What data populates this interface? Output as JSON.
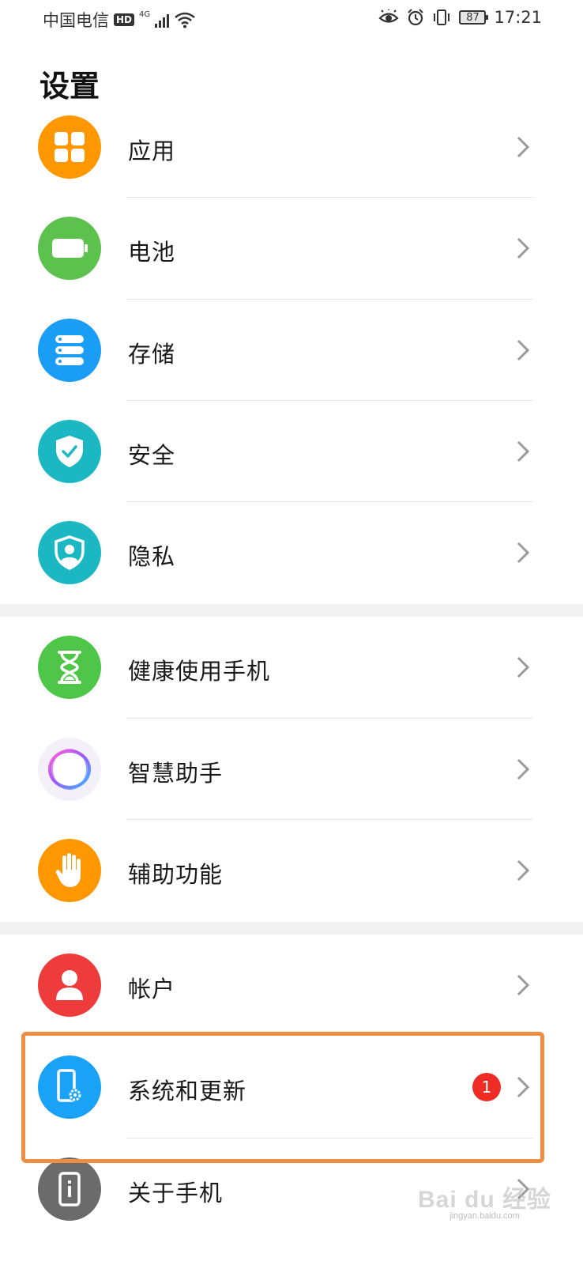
{
  "status_bar": {
    "carrier": "中国电信",
    "hd": "HD",
    "network": "4G",
    "battery": "87",
    "time": "17:21"
  },
  "page_title": "设置",
  "items": [
    {
      "label": "应用",
      "icon": "apps-icon",
      "color": "#ff9800"
    },
    {
      "label": "电池",
      "icon": "battery-icon",
      "color": "#5cc24d"
    },
    {
      "label": "存储",
      "icon": "storage-icon",
      "color": "#1a9ef5"
    },
    {
      "label": "安全",
      "icon": "security-shield-icon",
      "color": "#1bb8c4"
    },
    {
      "label": "隐私",
      "icon": "privacy-shield-icon",
      "color": "#1bb8c4"
    },
    {
      "label": "健康使用手机",
      "icon": "hourglass-icon",
      "color": "#4fc64a"
    },
    {
      "label": "智慧助手",
      "icon": "assistant-ring-icon",
      "color": "#f3eff6"
    },
    {
      "label": "辅助功能",
      "icon": "hand-icon",
      "color": "#ff9800"
    },
    {
      "label": "帐户",
      "icon": "user-icon",
      "color": "#ee3b3b"
    },
    {
      "label": "系统和更新",
      "icon": "phone-gear-icon",
      "color": "#1aa2f6",
      "badge": "1"
    },
    {
      "label": "关于手机",
      "icon": "phone-info-icon",
      "color": "#6b6b6b"
    }
  ],
  "watermark": {
    "brand": "Bai du 经验",
    "url": "jingyan.baidu.com"
  },
  "colors": {
    "highlight": "#ef8d43",
    "badge": "#ee2b24"
  }
}
